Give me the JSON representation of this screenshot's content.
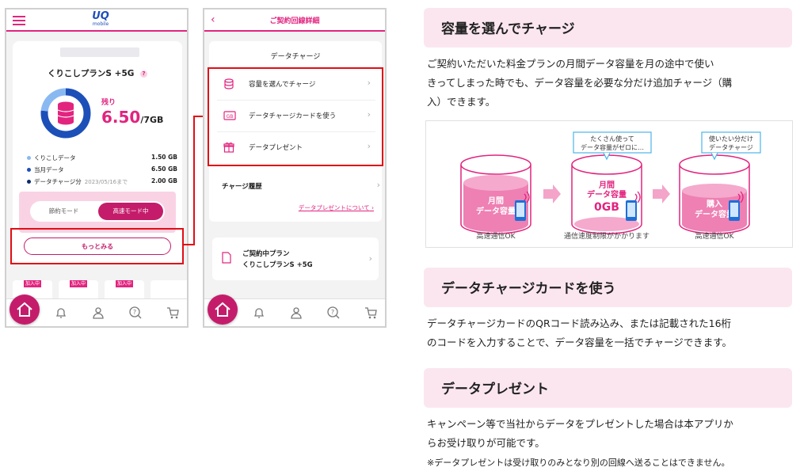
{
  "phone1": {
    "logo_main": "UQ",
    "logo_sub": "mobile",
    "plan_name": "くりこしプランS +5G",
    "plan_help": "?",
    "remain_label": "残り",
    "remain_value": "6.50",
    "remain_unit": "/7GB",
    "data_rows": [
      {
        "label": "くりこしデータ",
        "date": "",
        "value": "1.50 GB",
        "color": "#8ab9f2"
      },
      {
        "label": "当月データ",
        "date": "",
        "value": "6.50 GB",
        "color": "#1d4fb8"
      },
      {
        "label": "データチャージ分",
        "date": "2023/05/16まで",
        "value": "2.00 GB",
        "color": "#0c2a6b"
      }
    ],
    "mode_eco": "節約モード",
    "mode_fast": "高速モード中",
    "more_button": "もっとみる",
    "tile_badge": "加入中"
  },
  "phone2": {
    "back_icon": "‹",
    "title": "ご契約回線詳細",
    "section_title": "データチャージ",
    "menu": [
      {
        "label": "容量を選んでチャージ",
        "icon": "database-icon"
      },
      {
        "label": "データチャージカードを使う",
        "icon": "gb-card-icon"
      },
      {
        "label": "データプレゼント",
        "icon": "gift-icon"
      }
    ],
    "history": "チャージ履歴",
    "present_link": "データプレゼントについて",
    "plan_card_line1": "ご契約中プラン",
    "plan_card_line2": "くりこしプランS +5G"
  },
  "sections": [
    {
      "heading": "容量を選んでチャージ",
      "body_lines": [
        "ご契約いただいた料金プランの月間データ容量を月の途中で使い",
        "きってしまった時でも、データ容量を必要な分だけ追加チャージ（購",
        "入）できます。"
      ]
    },
    {
      "heading": "データチャージカードを使う",
      "body_lines": [
        "データチャージカードのQRコード読み込み、または記載された16桁",
        "のコードを入力することで、データ容量を一括でチャージできます。"
      ]
    },
    {
      "heading": "データプレゼント",
      "body_lines": [
        "キャンペーン等で当社からデータをプレゼントした場合は本アプリか",
        "らお受け取りが可能です。"
      ],
      "note": "※データプレゼントは受け取りのみとなり別の回線へ送ることはできません。"
    }
  ],
  "illustration": {
    "cyl1_line1": "月間",
    "cyl1_line2": "データ容量",
    "cyl1_caption": "高速通信OK",
    "cyl2_line1": "月間",
    "cyl2_line2": "データ容量",
    "cyl2_line3": "0GB",
    "cyl2_caption": "通信速度制限がかかります",
    "cyl3_line1": "購入",
    "cyl3_line2": "データ容量",
    "cyl3_caption": "高速通信OK",
    "bubble1_line1": "たくさん使って",
    "bubble1_line2": "データ容量がゼロに…",
    "bubble2_line1": "使いたい分だけ",
    "bubble2_line2": "データチャージ"
  },
  "colors": {
    "brand_pink": "#e2247f",
    "dark_pink": "#c41c6b",
    "highlight_red": "#e10e16",
    "header_bg": "#fbe6ef"
  }
}
